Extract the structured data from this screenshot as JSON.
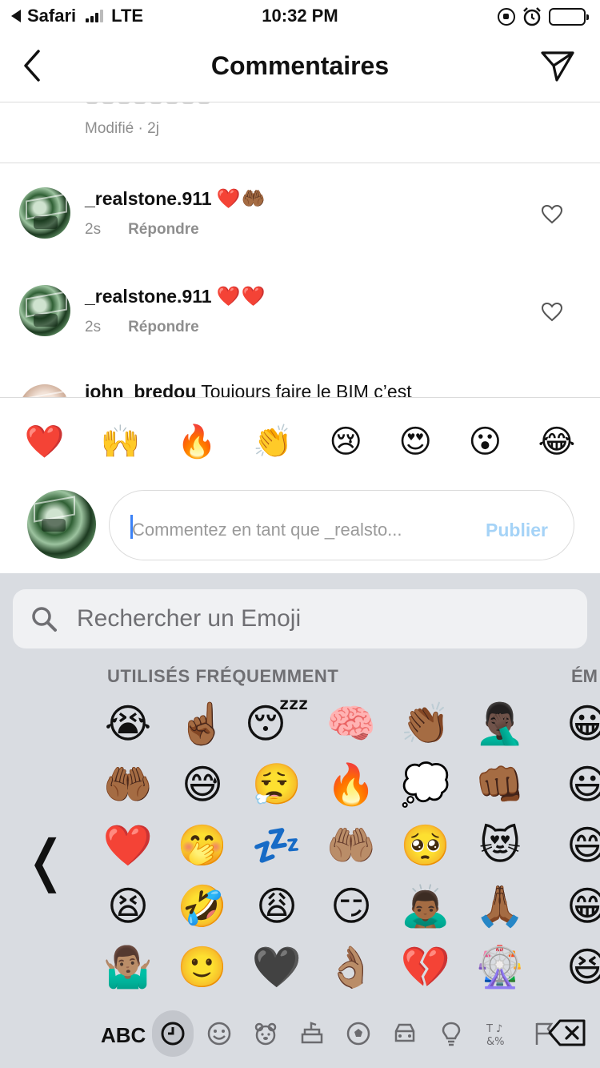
{
  "status_bar": {
    "carrier": "Safari",
    "network": "LTE",
    "time": "10:32 PM"
  },
  "header": {
    "title": "Commentaires"
  },
  "comments": {
    "edited_meta": "Modifié · 2j",
    "items": [
      {
        "username": "_realstone.911",
        "emoji": "❤️🤲🏾",
        "age": "2s",
        "reply_label": "Répondre"
      },
      {
        "username": "_realstone.911",
        "emoji": "❤️❤️",
        "age": "2s",
        "reply_label": "Répondre"
      }
    ],
    "partial": {
      "username": "john_bredou",
      "text": "Toujours faire le BIM c’est"
    }
  },
  "quick_reactions": [
    "❤️",
    "🙌",
    "🔥",
    "👏",
    "😢",
    "😍",
    "😮",
    "😂"
  ],
  "composer": {
    "placeholder": "Commentez en tant que _realsto...",
    "publish_label": "Publier"
  },
  "keyboard": {
    "search_placeholder": "Rechercher un Emoji",
    "section_title": "UTILISÉS FRÉQUEMMENT",
    "next_section_title": "ÉM",
    "abc_label": "ABC",
    "emoji_grid": [
      "😭",
      "☝🏾",
      "😴",
      "🧠",
      "👏🏾",
      "🤦🏿‍♂️",
      "🤲🏾",
      "😅",
      "😮‍💨",
      "🔥",
      "💭",
      "👊🏾",
      "❤️",
      "🤭",
      "💤",
      "🤲🏽",
      "🥺",
      "😻",
      "😫",
      "🤣",
      "😩",
      "😏",
      "🙇🏾‍♂️",
      "🙏🏾",
      "🤷🏽‍♂️",
      "🙂",
      "🖤",
      "👌🏽",
      "💔",
      "🎡"
    ],
    "next_column": [
      "😀",
      "😃",
      "😄",
      "😁",
      "😆"
    ],
    "categories": [
      {
        "name": "recent",
        "active": true
      },
      {
        "name": "smileys",
        "active": false
      },
      {
        "name": "animals",
        "active": false
      },
      {
        "name": "food",
        "active": false
      },
      {
        "name": "activity",
        "active": false
      },
      {
        "name": "travel",
        "active": false
      },
      {
        "name": "objects",
        "active": false
      },
      {
        "name": "symbols",
        "active": false
      },
      {
        "name": "flags",
        "active": false
      }
    ]
  }
}
